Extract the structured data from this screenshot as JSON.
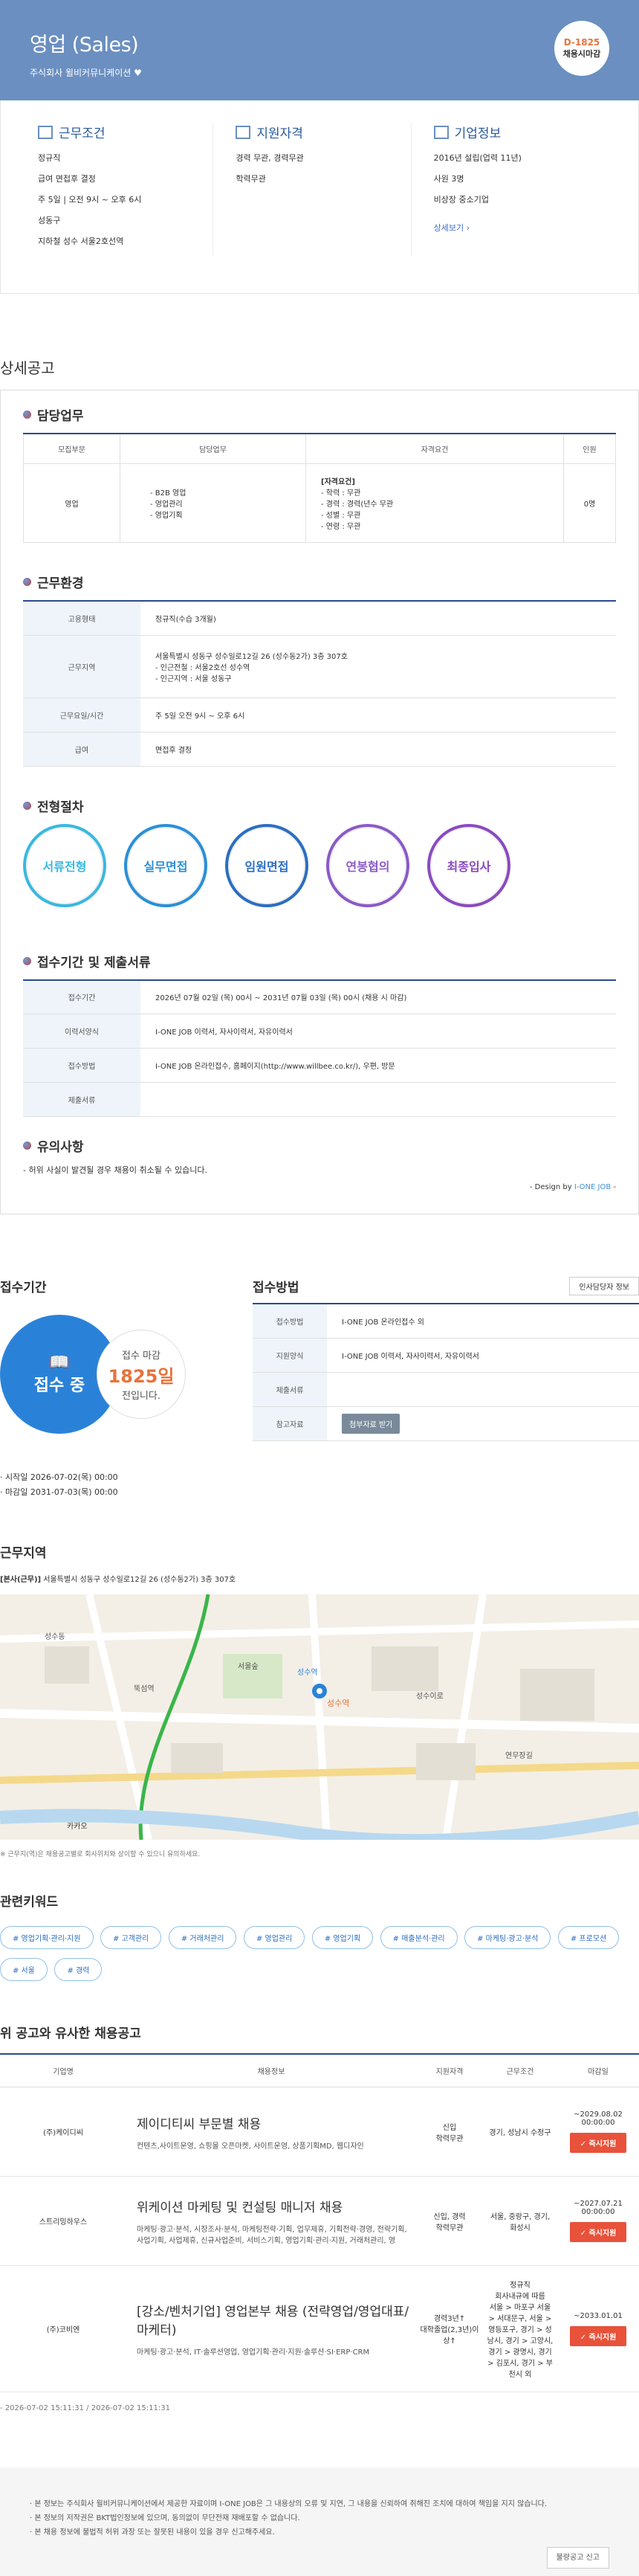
{
  "header": {
    "title": "영업 (Sales)",
    "company": "주식회사 윌비커뮤니케이션",
    "dday": "D-1825",
    "dday_label": "채용시마감"
  },
  "summary": {
    "work": {
      "title": "근무조건",
      "items": [
        "정규직",
        "급여 면접후 결정",
        "주 5일 | 오전 9시 ~ 오후 6시",
        "성동구",
        "지하철 성수 서울2호선역"
      ]
    },
    "qual": {
      "title": "지원자격",
      "items": [
        "경력 무관, 경력무관",
        "학력무관"
      ]
    },
    "corp": {
      "title": "기업정보",
      "items": [
        "2016년 설립(업력 11년)",
        "사원 3명",
        "비상장 중소기업"
      ],
      "link": "상세보기"
    }
  },
  "detail": {
    "heading": "상세공고",
    "duty": {
      "title": "담당업무",
      "headers": [
        "모집부문",
        "담당업무",
        "자격요건",
        "인원"
      ],
      "row": {
        "dept": "영업",
        "tasks": [
          "- B2B 영업",
          "- 영업관리",
          "- 영업기획"
        ],
        "req_title": "[자격요건]",
        "reqs": [
          "- 학력 : 무관",
          "- 경력 : 경력(년수 무관",
          "- 성별 : 무관",
          "- 연령 : 무관"
        ],
        "count": "0명"
      }
    },
    "env": {
      "title": "근무환경",
      "rows": [
        {
          "k": "고용형태",
          "v": [
            "정규직(수습 3개월)"
          ]
        },
        {
          "k": "근무지역",
          "v": [
            "서울특별시 성동구 성수일로12길 26 (성수동2가) 3층 307호",
            "- 인근전철 : 서울2호선 성수역",
            "- 인근지역 : 서울 성동구"
          ]
        },
        {
          "k": "근무요일/시간",
          "v": [
            "주 5일 오전 9시 ~ 오후 6시"
          ]
        },
        {
          "k": "급여",
          "v": [
            "면접후 결정"
          ]
        }
      ]
    },
    "process": {
      "title": "전형절차",
      "steps": [
        "서류전형",
        "실무면접",
        "임원면접",
        "연봉협의",
        "최종입사"
      ]
    },
    "period": {
      "title": "접수기간 및 제출서류",
      "rows": [
        {
          "k": "접수기간",
          "v": "2026년 07월 02일 (목) 00시 ~ 2031년 07월 03일 (목) 00시 (채용 시 마감)"
        },
        {
          "k": "이력서양식",
          "v": "I-ONE JOB 이력서, 자사이력서, 자유이력서"
        },
        {
          "k": "접수방법",
          "v": "I-ONE JOB 온라인접수, 홈페이지(http://www.willbee.co.kr/), 우편, 방문"
        },
        {
          "k": "제출서류",
          "v": ""
        }
      ]
    },
    "notice": {
      "title": "유의사항",
      "text": "- 허위 사실이 발견될 경우 채용이 취소될 수 있습니다.",
      "design": "- Design by ",
      "design_brand": "I-ONE JOB",
      "design_tail": " -"
    }
  },
  "apply": {
    "period_title": "접수기간",
    "status": "접수 중",
    "remain_label": "접수 마감",
    "remain_days": "1825일",
    "remain_tail": "전입니다.",
    "start": "· 시작일 2026-07-02(목) 00:00",
    "end": "· 마감일 2031-07-03(목) 00:00",
    "method_title": "접수방법",
    "hr_button": "인사담당자 정보",
    "rows": [
      {
        "k": "접수방법",
        "v": "I-ONE JOB 온라인접수 외"
      },
      {
        "k": "지원양식",
        "v": "I-ONE JOB 이력서, 자사이력서, 자유이력서"
      },
      {
        "k": "제출서류",
        "v": ""
      },
      {
        "k": "참고자료",
        "v": ""
      }
    ],
    "attach_button": "첨부자료 받기"
  },
  "location": {
    "title": "근무지역",
    "prefix": "[본사(근무)]",
    "address": " 서울특별시 성동구 성수일로12길 26 (성수동2가) 3층 307호",
    "note": "※ 근무지(역)은 채용공고별로 회사위치와 상이할 수 있으니 유의하세요.",
    "marker": "성수역",
    "map_labels": [
      "성수동",
      "뚝섬역",
      "서울숲",
      "성수역",
      "성수이로",
      "연무장길",
      "카카오"
    ]
  },
  "keywords": {
    "title": "관련키워드",
    "items": [
      "# 영업기획·관리·지원",
      "# 고객관리",
      "# 거래처관리",
      "# 영업관리",
      "# 영업기획",
      "# 매출분석·관리",
      "# 마케팅·광고·분석",
      "# 프로모션",
      "# 서울",
      "# 경력"
    ]
  },
  "similar": {
    "title": "위 공고와 유사한 채용공고",
    "headers": [
      "기업명",
      "채용정보",
      "지원자격",
      "근무조건",
      "마감일"
    ],
    "rows": [
      {
        "corp": "(주)케이디씨",
        "title": "제이디티씨 부문별 채용",
        "desc": "컨텐츠,사이트운영, 쇼핑몰 오픈마켓, 사이트운영, 상품기획MD, 웹디자인",
        "qual": "신입\n학력무관",
        "cond": "경기, 성남시 수정구",
        "due": "~2029.08.02 00:00:00",
        "btn": "✓ 즉시지원"
      },
      {
        "corp": "스트리밍하우스",
        "title": "위케이션 마케팅 및 컨설팅 매니저 채용",
        "desc": "마케팅·광고·분석, 시장조사·분석, 마케팅전략·기획, 업무제휴, 기획전략·경영, 전략기획, 사업기획, 사업제휴, 신규사업준비, 서비스기획, 영업기획·관리·지원, 거래처관리, 영",
        "qual": "신입, 경력\n학력무관",
        "cond": "서울, 중랑구, 경기, 화성시",
        "due": "~2027.07.21 00:00:00",
        "btn": "✓ 즉시지원"
      },
      {
        "corp": "(주)코비엔",
        "title": "[강소/벤처기업] 영업본부 채용 (전략영업/영업대표/마케터)",
        "desc": "마케팅·광고·분석, IT·솔루션영업, 영업기획·관리·지원·솔루션·SI·ERP·CRM",
        "qual": "경력3년↑\n대학졸업(2,3년)이상↑",
        "cond": "정규직\n회사내규에 따름\n서울 > 마포구 서울 > 서대문구, 서울 > 영등포구, 경기 > 성남시, 경기 > 고양시, 경기 > 광명시, 경기 > 김포시, 경기 > 부천시 외",
        "due": "~2033.01.01",
        "btn": "✓ 즉시지원"
      }
    ],
    "dates": "- 2026-07-02 15:11:31 / 2026-07-02 15:11:31"
  },
  "footer": {
    "lines": [
      "· 본 정보는 주식회사 윌비커뮤니케이션에서 제공한 자료이며 I-ONE JOB은 그 내용상의 오류 및 지연, 그 내용을 신뢰하여 취해진 조치에 대하여 책임을 지지 않습니다.",
      "· 본 정보의 저작권은 BKT법인정보에 있으며, 동의없이 무단전재 재배포할 수 없습니다.",
      "· 본 채용 정보에 불법적 허위 과장 또는 잘못된 내용이 있을 경우 신고해주세요."
    ],
    "report": "불량공고 신고"
  },
  "colors": {
    "header": "#6b8fc0",
    "steps": [
      "#39b8e0",
      "#2a8fd8",
      "#2a6ec2",
      "#8a5ac8",
      "#8a4ac0"
    ]
  }
}
